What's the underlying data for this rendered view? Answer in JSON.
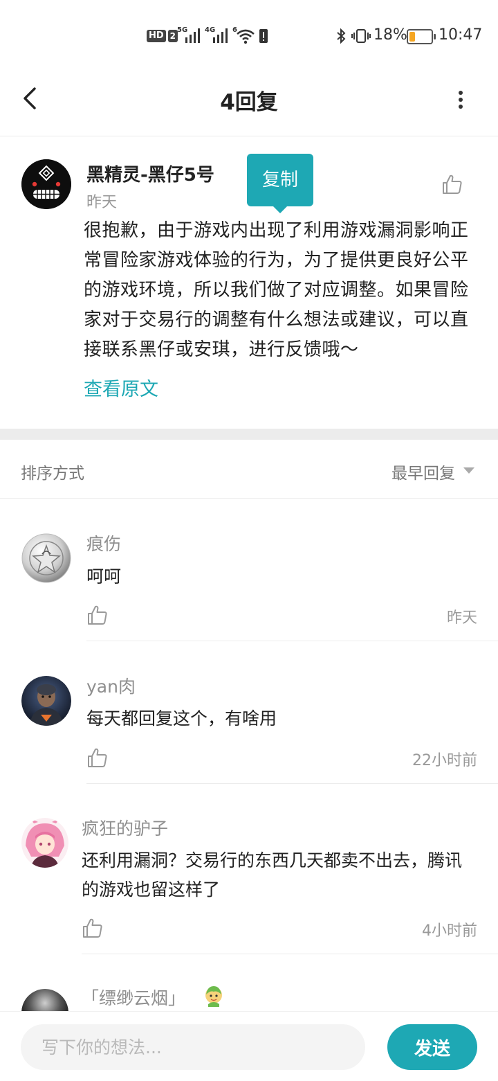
{
  "status_bar": {
    "hd_label": "HD",
    "hd_num": "2",
    "signal1": "5G",
    "signal2": "4G",
    "wifi_badge": "6",
    "battery_pct": "18%",
    "battery_level": 0.18,
    "time": "10:47"
  },
  "header": {
    "title": "4回复"
  },
  "post": {
    "author": "黑精灵-黑仔5号",
    "time": "昨天",
    "copy_label": "复制",
    "body": "很抱歉，由于游戏内出现了利用游戏漏洞影响正常冒险家游戏体验的行为，为了提供更良好公平的游戏环境，所以我们做了对应调整。如果冒险家对于交易行的调整有什么想法或建议，可以直接联系黑仔或安琪，进行反馈哦～",
    "view_original": "查看原文"
  },
  "sort": {
    "label": "排序方式",
    "value": "最早回复"
  },
  "comments": [
    {
      "name": "痕伤",
      "text": "呵呵",
      "time": "昨天"
    },
    {
      "name": "yan肉",
      "text": "每天都回复这个，有啥用",
      "time": "22小时前"
    },
    {
      "name": "疯狂的驴子",
      "text": "还利用漏洞？交易行的东西几天都卖不出去，腾讯的游戏也留这样了",
      "time": "4小时前"
    },
    {
      "name": "「缥缈云烟」",
      "text": "",
      "time": ""
    }
  ],
  "composer": {
    "placeholder": "写下你的想法...",
    "send_label": "发送"
  },
  "colors": {
    "accent": "#1ea8b4"
  }
}
